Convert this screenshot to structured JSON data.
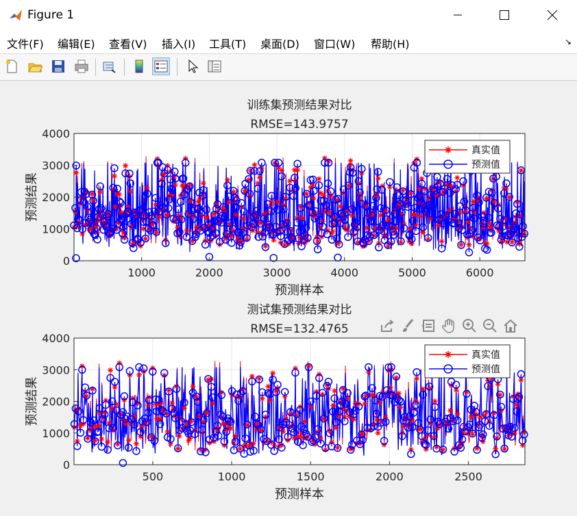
{
  "window": {
    "title": "Figure 1"
  },
  "menu": [
    "文件(F)",
    "编辑(E)",
    "查看(V)",
    "插入(I)",
    "工具(T)",
    "桌面(D)",
    "窗口(W)",
    "帮助(H)"
  ],
  "toolbar_icons": [
    "new-figure-icon",
    "open-file-icon",
    "save-icon",
    "print-icon",
    "link-plot-icon",
    "insert-colorbar-icon",
    "insert-legend-icon",
    "edit-plot-icon",
    "property-inspector-icon"
  ],
  "axes_toolbar_icons": [
    "export-icon",
    "brush-icon",
    "data-tips-icon",
    "pan-hand-icon",
    "zoom-in-icon",
    "zoom-out-icon",
    "home-icon"
  ],
  "colors": {
    "true_series": "#ff0000",
    "pred_series": "#0000ff"
  },
  "chart_data": [
    {
      "type": "line",
      "title": "训练集预测结果对比",
      "subtitle": "RMSE=143.9757",
      "xlabel": "预测样本",
      "ylabel": "预测结果",
      "xlim": [
        1,
        6667
      ],
      "ylim": [
        0,
        4000
      ],
      "xticks": [
        "1000",
        "2000",
        "3000",
        "4000",
        "5000",
        "6000"
      ],
      "yticks": [
        "0",
        "1000",
        "2000",
        "3000",
        "4000"
      ],
      "grid": true,
      "legend_position": "top-right",
      "legend": [
        "真实值",
        "预测值"
      ],
      "series": [
        {
          "name": "真实值",
          "marker": "*",
          "color": "#ff0000",
          "approx_range": [
            400,
            3350
          ],
          "n_points": 6667
        },
        {
          "name": "预测值",
          "marker": "o",
          "color": "#0000ff",
          "approx_range": [
            80,
            3050
          ],
          "n_points": 6667
        }
      ]
    },
    {
      "type": "line",
      "title": "测试集预测结果对比",
      "subtitle": "RMSE=132.4765",
      "xlabel": "预测样本",
      "ylabel": "预测结果",
      "xlim": [
        1,
        2858
      ],
      "ylim": [
        0,
        4000
      ],
      "xticks": [
        "500",
        "1000",
        "1500",
        "2000",
        "2500"
      ],
      "yticks": [
        "0",
        "1000",
        "2000",
        "3000",
        "4000"
      ],
      "grid": true,
      "legend_position": "top-right",
      "legend": [
        "真实值",
        "预测值"
      ],
      "series": [
        {
          "name": "真实值",
          "marker": "*",
          "color": "#ff0000",
          "approx_range": [
            400,
            3350
          ],
          "n_points": 2858
        },
        {
          "name": "预测值",
          "marker": "o",
          "color": "#0000ff",
          "approx_range": [
            50,
            3050
          ],
          "n_points": 2858
        }
      ]
    }
  ]
}
